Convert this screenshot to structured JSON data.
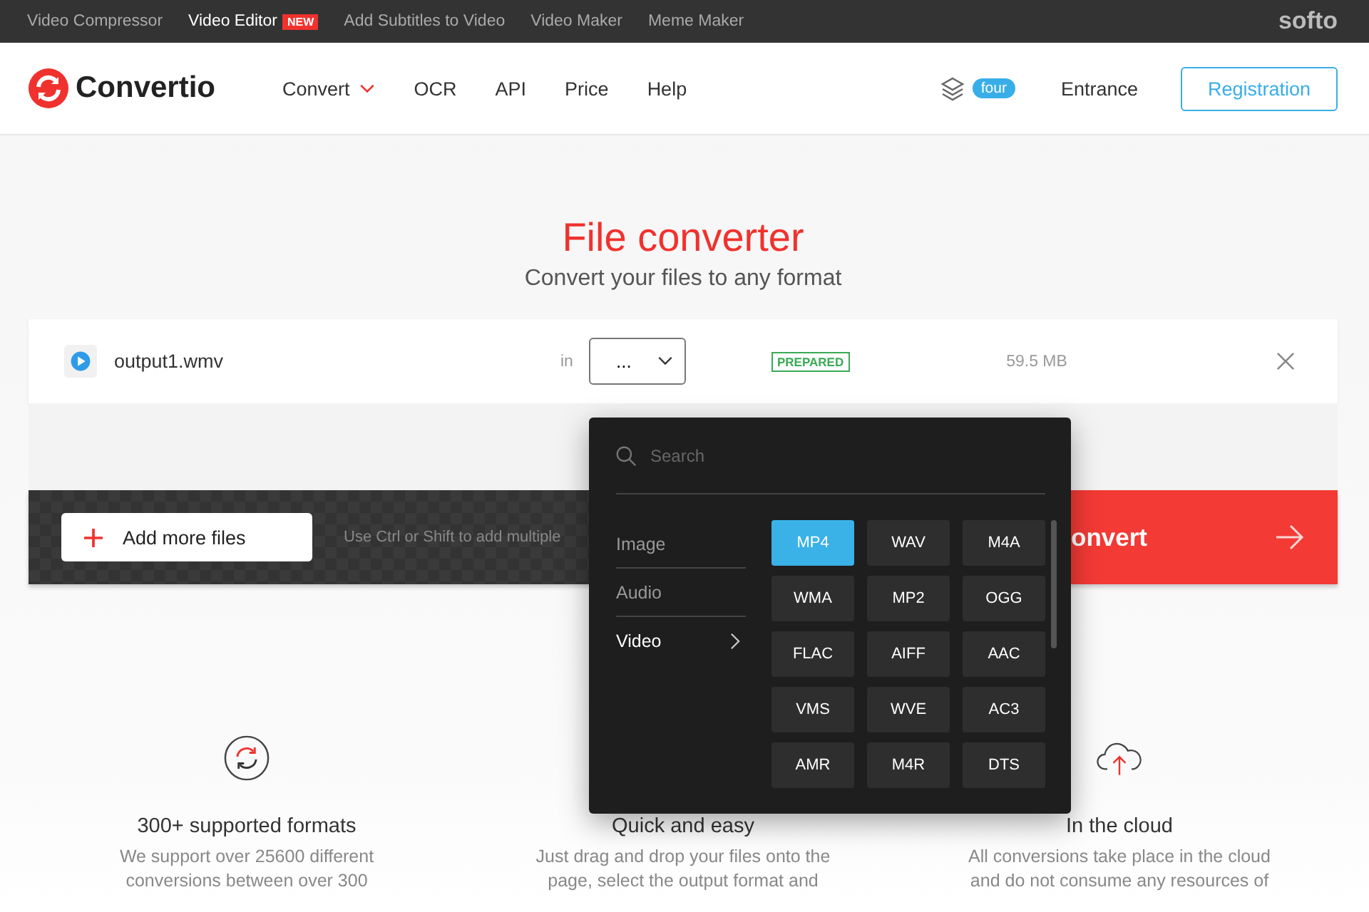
{
  "topbar": {
    "links": [
      {
        "label": "Video Compressor",
        "active": false
      },
      {
        "label": "Video Editor",
        "active": true,
        "badge": "NEW"
      },
      {
        "label": "Add Subtitles to Video",
        "active": false
      },
      {
        "label": "Video Maker",
        "active": false
      },
      {
        "label": "Meme Maker",
        "active": false
      }
    ],
    "brand": "softo"
  },
  "header": {
    "brand": "Convertio",
    "nav": [
      {
        "label": "Convert",
        "dropdown": true
      },
      {
        "label": "OCR",
        "dropdown": false
      },
      {
        "label": "API",
        "dropdown": false
      },
      {
        "label": "Price",
        "dropdown": false
      },
      {
        "label": "Help",
        "dropdown": false
      }
    ],
    "plan_badge": "four",
    "login": "Entrance",
    "register": "Registration"
  },
  "hero": {
    "title": "File converter",
    "subtitle": "Convert your files to any format"
  },
  "file": {
    "name": "output1.wmv",
    "in_label": "in",
    "format": "...",
    "status": "PREPARED",
    "size": "59.5 MB"
  },
  "actions": {
    "add": "Add more files",
    "hint": "Use Ctrl or Shift to add multiple",
    "convert": "onvert"
  },
  "dropdown": {
    "search": {
      "placeholder": "Search"
    },
    "categories": [
      {
        "label": "Image",
        "selected": false
      },
      {
        "label": "Audio",
        "selected": false
      },
      {
        "label": "Video",
        "selected": true
      }
    ],
    "formats": [
      {
        "label": "MP4",
        "selected": true
      },
      {
        "label": "WAV",
        "selected": false
      },
      {
        "label": "M4A",
        "selected": false
      },
      {
        "label": "WMA",
        "selected": false
      },
      {
        "label": "MP2",
        "selected": false
      },
      {
        "label": "OGG",
        "selected": false
      },
      {
        "label": "FLAC",
        "selected": false
      },
      {
        "label": "AIFF",
        "selected": false
      },
      {
        "label": "AAC",
        "selected": false
      },
      {
        "label": "VMS",
        "selected": false
      },
      {
        "label": "WVE",
        "selected": false
      },
      {
        "label": "AC3",
        "selected": false
      },
      {
        "label": "AMR",
        "selected": false
      },
      {
        "label": "M4R",
        "selected": false
      },
      {
        "label": "DTS",
        "selected": false
      }
    ]
  },
  "features": [
    {
      "title": "300+ supported formats",
      "text": "We support over 25600 different conversions between over 300"
    },
    {
      "title": "Quick and easy",
      "text": "Just drag and drop your files onto the page, select the output format and"
    },
    {
      "title": "In the cloud",
      "text": "All conversions take place in the cloud and do not consume any resources of"
    }
  ]
}
